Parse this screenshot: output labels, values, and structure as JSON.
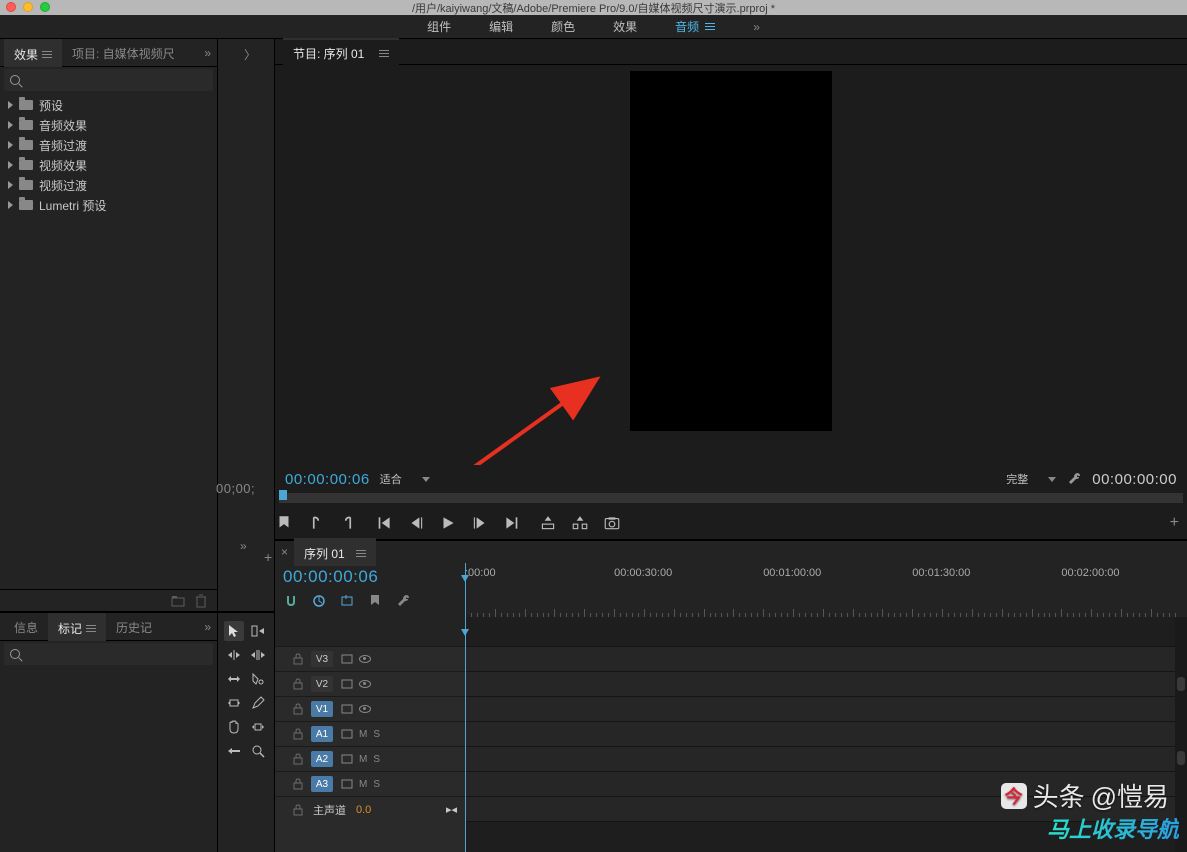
{
  "title_path": "/用户/kaiyiwang/文稿/Adobe/Premiere Pro/9.0/自媒体视频尺寸演示.prproj *",
  "workspaces": {
    "items": [
      "组件",
      "编辑",
      "颜色",
      "效果",
      "音频"
    ],
    "active": "音频"
  },
  "left": {
    "tabs": {
      "effects": "效果",
      "project": "项目: 自媒体视频尺"
    },
    "effects_tree": [
      "预设",
      "音频效果",
      "音频过渡",
      "视频效果",
      "视频过渡",
      "Lumetri 预设"
    ],
    "info_tabs": {
      "info": "信息",
      "markers": "标记",
      "history": "历史记"
    }
  },
  "source": {
    "timecode": "00;00;"
  },
  "program": {
    "tab_label": "节目: 序列 01",
    "timecode_left": "00:00:00:06",
    "zoom_label": "适合",
    "res_label": "完整",
    "timecode_right": "00:00:00:00"
  },
  "timeline": {
    "tab_label": "序列 01",
    "timecode": "00:00:00:06",
    "ruler": [
      ":00:00",
      "00:00:30:00",
      "00:01:00:00",
      "00:01:30:00",
      "00:02:00:00"
    ],
    "ruler_pos": [
      0,
      21,
      42,
      63,
      84
    ],
    "video_tracks": [
      "V3",
      "V2",
      "V1"
    ],
    "audio_tracks": [
      "A1",
      "A2",
      "A3"
    ],
    "master_label": "主声道",
    "master_value": "0.0"
  },
  "watermark1_prefix": "头条",
  "watermark1_user": "@愷易",
  "watermark2": "马上收录导航"
}
